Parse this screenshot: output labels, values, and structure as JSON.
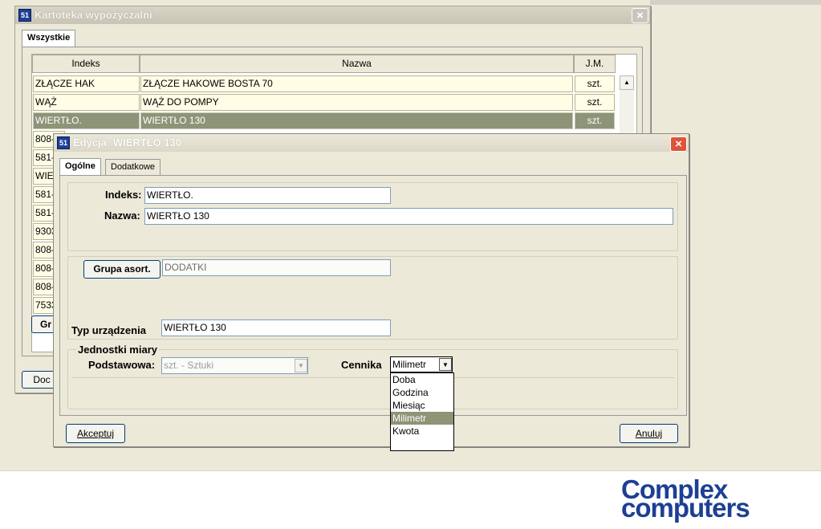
{
  "main_window": {
    "title": "Kartoteka wypożyczalni",
    "tab": "Wszystkie",
    "columns": [
      "Indeks",
      "Nazwa",
      "J.M."
    ],
    "rows": [
      {
        "indeks": "ZŁĄCZE HAK",
        "nazwa": "ZŁĄCZE HAKOWE BOSTA 70",
        "jm": "szt."
      },
      {
        "indeks": "WĄŻ",
        "nazwa": "WĄŻ DO POMPY",
        "jm": "szt."
      },
      {
        "indeks": "WIERTŁO.",
        "nazwa": "WIERTŁO 130",
        "jm": "szt."
      }
    ],
    "partial_rows": [
      "808-",
      "581-",
      "WIE",
      "581-",
      "581-",
      "9303",
      "808-",
      "808-",
      "808-",
      "7533"
    ],
    "gr_button": "Gr",
    "doc_button": "Doc"
  },
  "edit_dialog": {
    "title": "Edycja: WIERTŁO 130",
    "tabs": [
      "Ogólne",
      "Dodatkowe"
    ],
    "indeks_label": "Indeks:",
    "indeks_value": "WIERTŁO.",
    "nazwa_label": "Nazwa:",
    "nazwa_value": "WIERTŁO 130",
    "grupa_button": "Grupa asort.",
    "grupa_value": "DODATKI",
    "typ_label": "Typ urządzenia",
    "typ_value": "WIERTŁO 130",
    "jednostki_group": "Jednostki miary",
    "podstawowa_label": "Podstawowa:",
    "podstawowa_value": "szt. - Sztuki",
    "cennika_label": "Cennika",
    "cennika_value": "Milimetr",
    "cennika_options": [
      "Doba",
      "Godzina",
      "Miesiąc",
      "Milimetr",
      "Kwota"
    ],
    "accept_button": "Akceptuj",
    "cancel_button": "Anuluj"
  },
  "logo": {
    "line1": "Complex",
    "line2": "computers",
    "color": "#1d3f94"
  }
}
